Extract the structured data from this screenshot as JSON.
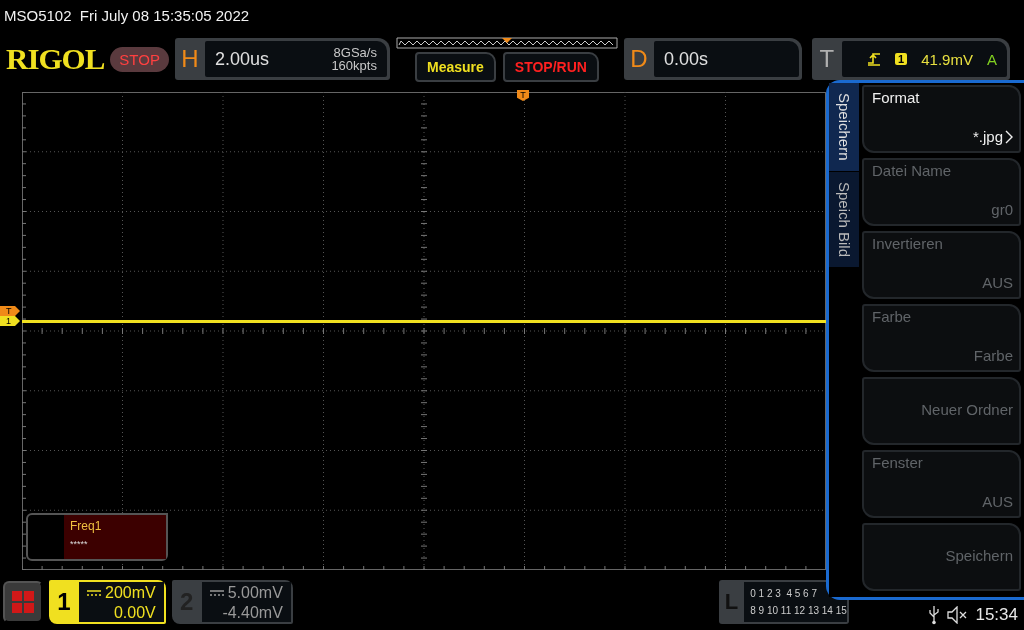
{
  "title_bar": {
    "text": "MSO5102  Fri July 08 15:35:05 2022"
  },
  "header": {
    "logo": "RIGOL",
    "run_state": "STOP",
    "horizontal": {
      "letter": "H",
      "timebase": "2.00us",
      "sample_rate": "8GSa/s",
      "memory_depth": "160kpts"
    },
    "buttons": [
      {
        "label": "Measure",
        "kind": "measure"
      },
      {
        "label": "STOP/RUN",
        "kind": "stoprun"
      }
    ],
    "delay": {
      "letter": "D",
      "value": "0.00s"
    },
    "trigger": {
      "letter": "T",
      "source": "1",
      "level": "41.9mV",
      "mode": "A"
    }
  },
  "waveform": {
    "top_marker": "T",
    "trigger_marker": "T",
    "channel_marker": "1"
  },
  "measurement": {
    "label": "Freq1",
    "value": "*****"
  },
  "side_menu": {
    "tabs": [
      {
        "label": "Speichern",
        "selected": true
      },
      {
        "label": "Speich Bild",
        "selected": false
      }
    ],
    "items": [
      {
        "label": "Format",
        "value": "*.jpg",
        "disabled": false,
        "submenu": true
      },
      {
        "label": "Datei Name",
        "value": "gr0",
        "disabled": true,
        "submenu": false
      },
      {
        "label": "Invertieren",
        "value": "AUS",
        "disabled": true,
        "submenu": false
      },
      {
        "label": "Farbe",
        "value": "Farbe",
        "disabled": true,
        "submenu": false
      },
      {
        "value": "Neuer Ordner",
        "disabled": true,
        "submenu": false
      },
      {
        "label": "Fenster",
        "value": "AUS",
        "disabled": true,
        "submenu": false
      },
      {
        "value": "Speichern",
        "disabled": true,
        "submenu": false
      }
    ]
  },
  "channels": [
    {
      "number": "1",
      "scale": "200mV",
      "offset": "0.00V",
      "selected": true
    },
    {
      "number": "2",
      "scale": "5.00mV",
      "offset": "-4.40mV",
      "selected": false
    }
  ],
  "logic": {
    "letter": "L",
    "rows": [
      "0 1 2 3  4 5 6 7",
      "8 9 10 11 12 13 14 15"
    ]
  },
  "status_bar": {
    "time": "15:34"
  }
}
